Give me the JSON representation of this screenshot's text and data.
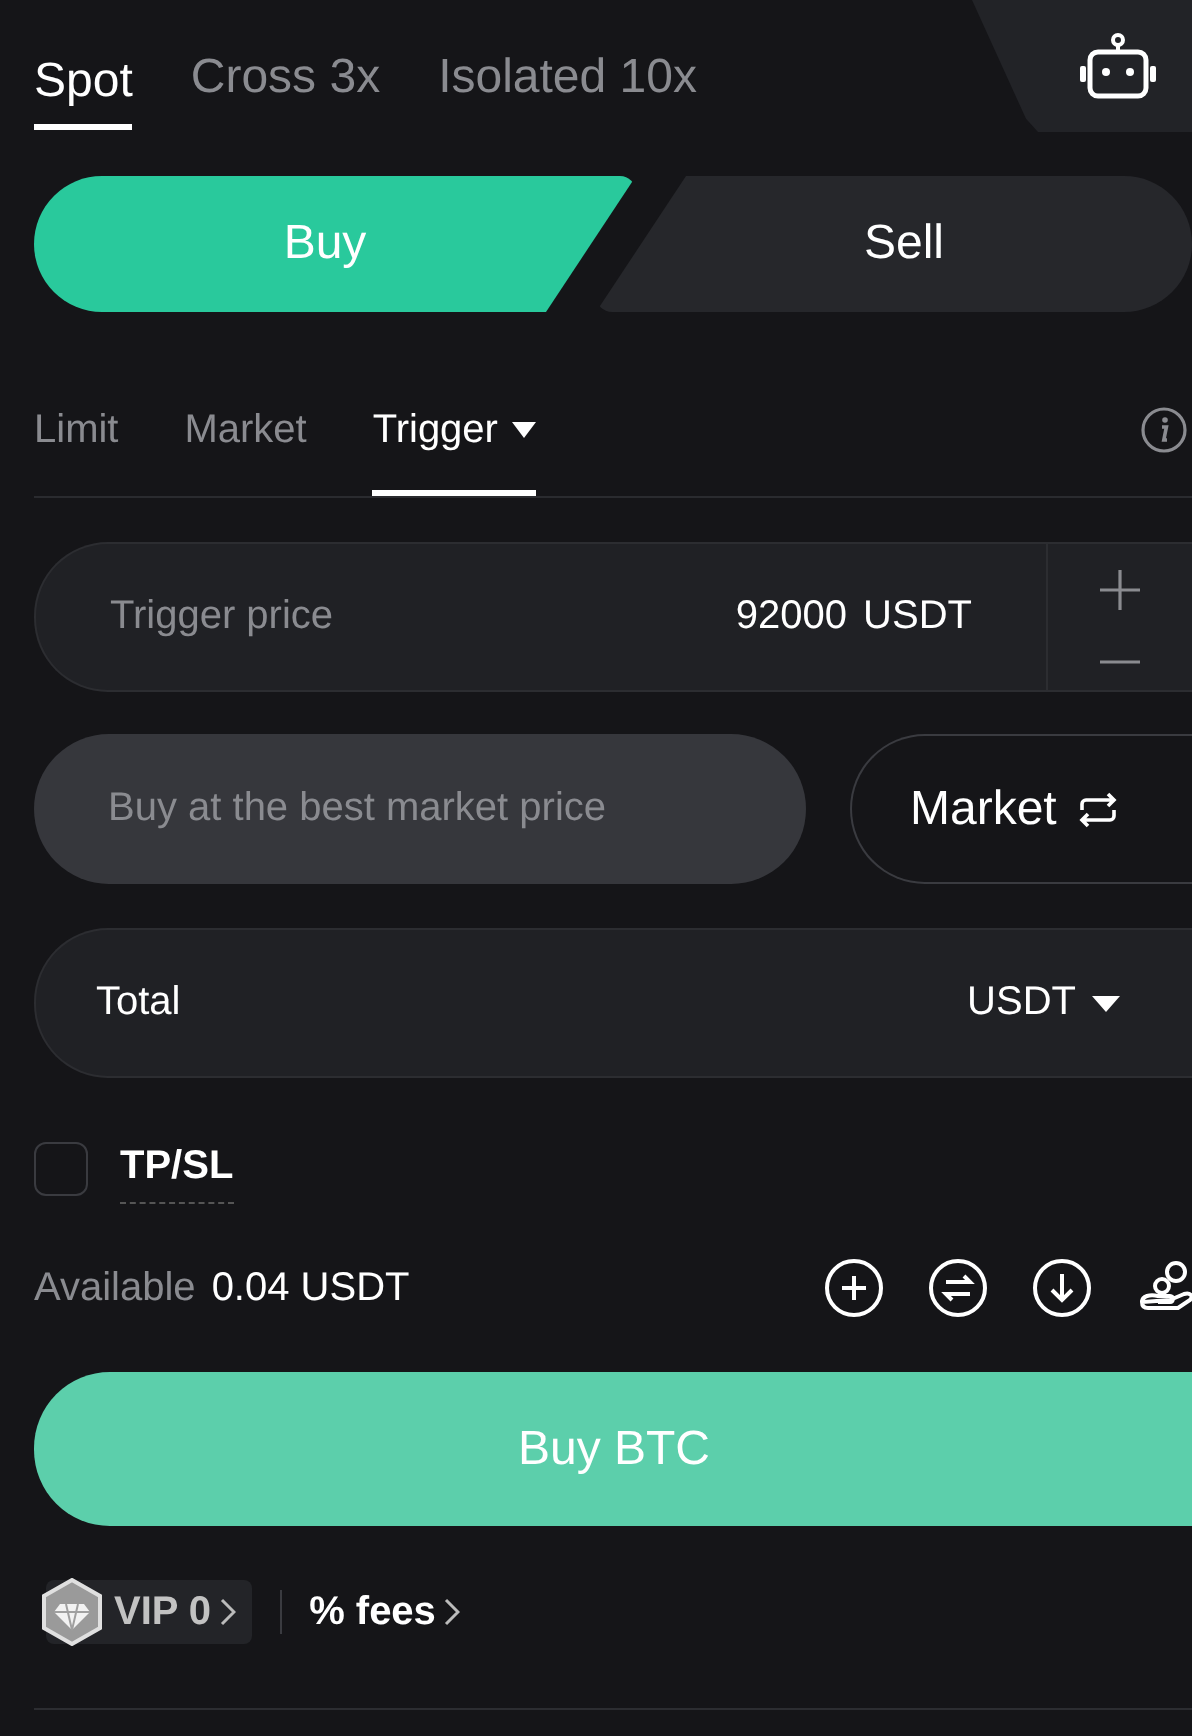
{
  "margin_tabs": [
    {
      "label": "Spot",
      "selected": true
    },
    {
      "label": "Cross 3x",
      "selected": false
    },
    {
      "label": "Isolated 10x",
      "selected": false
    }
  ],
  "side": [
    {
      "label": "Buy",
      "selected": true
    },
    {
      "label": "Sell",
      "selected": false
    }
  ],
  "order_types": [
    {
      "label": "Limit",
      "selected": false,
      "dropdown": false
    },
    {
      "label": "Market",
      "selected": false,
      "dropdown": false
    },
    {
      "label": "Trigger",
      "selected": true,
      "dropdown": true
    }
  ],
  "trigger_price": {
    "placeholder": "Trigger price",
    "value": "92000",
    "unit": "USDT"
  },
  "order_price": {
    "placeholder": "Buy at the best market price",
    "disabled": true
  },
  "price_mode_button": "Market",
  "total": {
    "label": "Total",
    "currency": "USDT"
  },
  "tpsl": {
    "label": "TP/SL",
    "checked": false
  },
  "available": {
    "label": "Available",
    "value": "0.04 USDT"
  },
  "submit_button": "Buy BTC",
  "vip": {
    "label": "VIP 0"
  },
  "fees_link": "% fees"
}
